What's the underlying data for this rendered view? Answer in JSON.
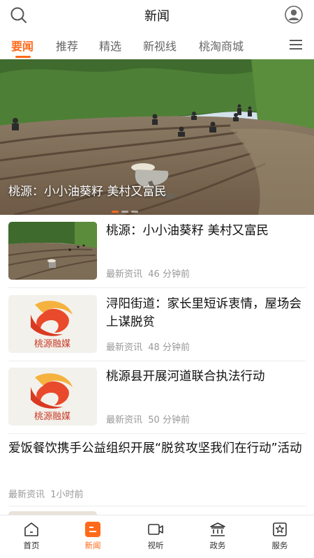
{
  "header": {
    "title": "新闻",
    "search_icon": "search-icon",
    "user_icon": "user-avatar-icon"
  },
  "tabs": [
    {
      "label": "要闻",
      "active": true
    },
    {
      "label": "推荐"
    },
    {
      "label": "精选"
    },
    {
      "label": "新视线"
    },
    {
      "label": "桃淘商城"
    }
  ],
  "banner": {
    "caption": "桃源：小小油葵籽 美村又富民"
  },
  "news": [
    {
      "title": "桃源：小小油葵籽 美村又富民",
      "source": "最新资讯",
      "time": "46 分钟前",
      "thumb": "farm-photo"
    },
    {
      "title": "浔阳街道：家长里短诉衷情，屋场会上谋脱贫",
      "source": "最新资讯",
      "time": "48 分钟前",
      "thumb": "taoyuan-logo"
    },
    {
      "title": "桃源县开展河道联合执法行动",
      "source": "最新资讯",
      "time": "50 分钟前",
      "thumb": "taoyuan-logo"
    }
  ],
  "text_news": {
    "title": "爱饭餐饮携手公益组织开展“脱贫攻坚我们在行动”活动",
    "source": "最新资讯",
    "time": "1小时前"
  },
  "logo_text": "桃源融媒",
  "bottom_nav": [
    {
      "label": "首页",
      "icon": "home-icon"
    },
    {
      "label": "新闻",
      "icon": "news-icon",
      "active": true
    },
    {
      "label": "视听",
      "icon": "video-icon"
    },
    {
      "label": "政务",
      "icon": "government-icon"
    },
    {
      "label": "服务",
      "icon": "service-icon"
    }
  ],
  "colors": {
    "accent": "#ff6a1a"
  }
}
